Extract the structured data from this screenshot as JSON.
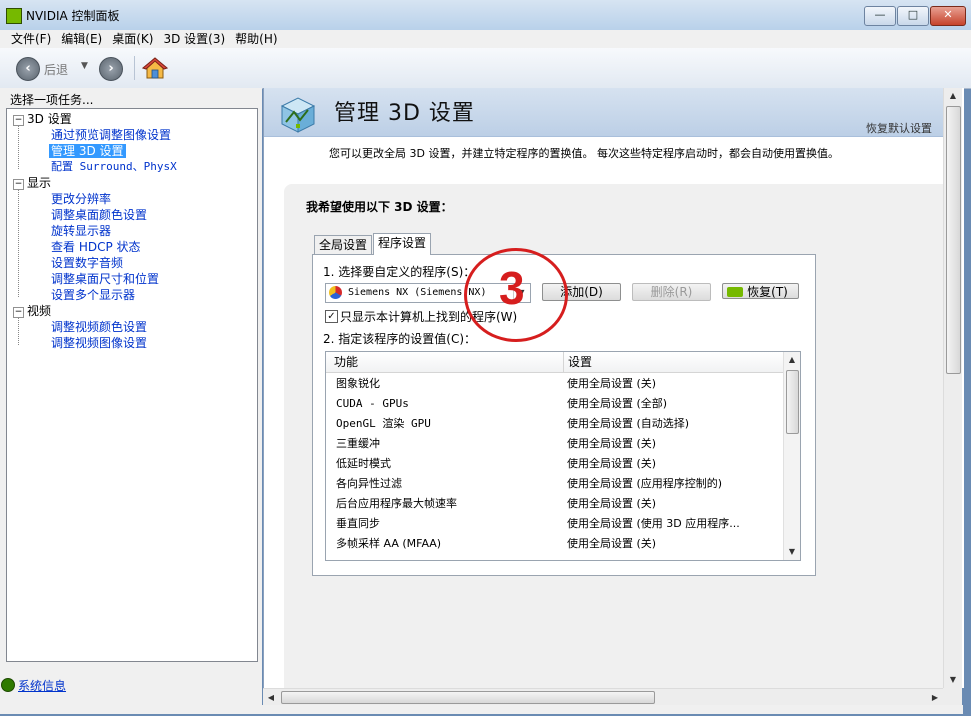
{
  "window": {
    "title": "NVIDIA 控制面板",
    "controls": {
      "minimize": "—",
      "maximize": "□",
      "close": "✕"
    }
  },
  "menu": [
    "文件(F)",
    "编辑(E)",
    "桌面(K)",
    "3D 设置(3)",
    "帮助(H)"
  ],
  "toolbar": {
    "back_label": "后退",
    "dropdown": "▼",
    "back_icon": "‹",
    "forward_icon": "›"
  },
  "sidebar": {
    "task_label": "选择一项任务...",
    "categories": [
      {
        "label": "3D 设置",
        "toggle": "−",
        "items": [
          "通过预览调整图像设置",
          "管理 3D 设置",
          "配置 Surround、PhysX"
        ]
      },
      {
        "label": "显示",
        "toggle": "−",
        "items": [
          "更改分辨率",
          "调整桌面颜色设置",
          "旋转显示器",
          "查看 HDCP 状态",
          "设置数字音频",
          "调整桌面尺寸和位置",
          "设置多个显示器"
        ]
      },
      {
        "label": "视频",
        "toggle": "−",
        "items": [
          "调整视频颜色设置",
          "调整视频图像设置"
        ]
      }
    ],
    "selected": "管理 3D 设置",
    "system_info": "系统信息"
  },
  "main": {
    "page_title": "管理 3D 设置",
    "restore_defaults": "恢复默认设置",
    "description": "您可以更改全局 3D 设置，并建立特定程序的置换值。 每次这些特定程序启动时，都会自动使用置换值。",
    "section_title": "我希望使用以下 3D 设置：",
    "tabs": [
      "全局设置",
      "程序设置"
    ],
    "active_tab": "程序设置",
    "step1_label": "1. 选择要自定义的程序(S)：",
    "program_select_value": "Siemens NX (Siemens NX)",
    "add_button": "添加(D)",
    "remove_button": "删除(R)",
    "restore_button": "恢复(T)",
    "only_found_checkbox": {
      "label": "只显示本计算机上找到的程序(W)",
      "checked": true,
      "mark": "✓"
    },
    "step2_label": "2. 指定该程序的设置值(C)：",
    "table": {
      "headers": [
        "功能",
        "设置"
      ],
      "rows": [
        [
          "图象锐化",
          "使用全局设置 (关)"
        ],
        [
          "CUDA - GPUs",
          "使用全局设置 (全部)"
        ],
        [
          "OpenGL 渲染 GPU",
          "使用全局设置 (自动选择)"
        ],
        [
          "三重缓冲",
          "使用全局设置 (关)"
        ],
        [
          "低延时模式",
          "使用全局设置 (关)"
        ],
        [
          "各向异性过滤",
          "使用全局设置 (应用程序控制的)"
        ],
        [
          "后台应用程序最大帧速率",
          "使用全局设置 (关)"
        ],
        [
          "垂直同步",
          "使用全局设置 (使用 3D 应用程序..."
        ],
        [
          "多帧采样 AA (MFAA)",
          "使用全局设置 (关)"
        ]
      ]
    },
    "annotation_number": "3"
  },
  "colors": {
    "accent_red": "#d61e1e",
    "nvidia_green": "#76b900",
    "link_blue": "#0033cc",
    "selection": "#3399ff"
  }
}
